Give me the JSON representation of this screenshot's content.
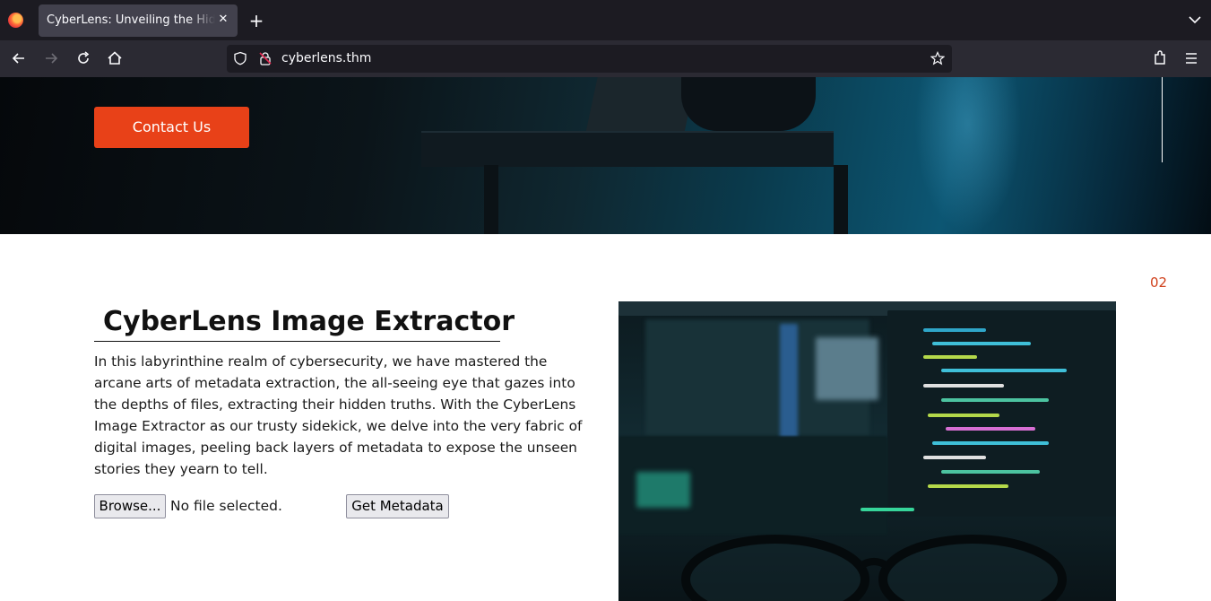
{
  "browser": {
    "tab_title": "CyberLens: Unveiling the Hidden",
    "url": "cyberlens.thm"
  },
  "hero": {
    "contact_label": "Contact Us"
  },
  "section": {
    "number": "02",
    "title": "CyberLens Image Extractor",
    "description": "In this labyrinthine realm of cybersecurity, we have mastered the arcane arts of metadata extraction, the all-seeing eye that gazes into the depths of files, extracting their hidden truths. With the CyberLens Image Extractor as our trusty sidekick, we delve into the very fabric of digital images, peeling back layers of metadata to expose the unseen stories they yearn to tell.",
    "browse_label": "Browse...",
    "file_status": "No file selected.",
    "submit_label": "Get Metadata"
  },
  "colors": {
    "accent": "#e84118",
    "browser_bg": "#1c1b22",
    "toolbar_bg": "#2b2a33"
  }
}
